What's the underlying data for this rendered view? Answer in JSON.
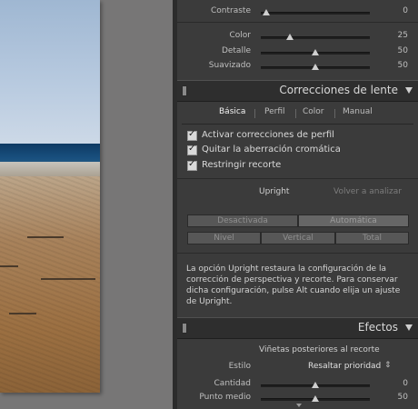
{
  "detail_sliders": [
    {
      "label": "Contraste",
      "value": "0",
      "pos": 0.05
    },
    {
      "label": "Color",
      "value": "25",
      "pos": 0.27
    },
    {
      "label": "Detalle",
      "value": "50",
      "pos": 0.5
    },
    {
      "label": "Suavizado",
      "value": "50",
      "pos": 0.5
    }
  ],
  "lens_section": {
    "title": "Correcciones de lente",
    "tabs": [
      "Básica",
      "Perfil",
      "Color",
      "Manual"
    ],
    "checkboxes": [
      "Activar correcciones de perfil",
      "Quitar la aberración cromática",
      "Restringir recorte"
    ],
    "upright_label": "Upright",
    "reanalyze_label": "Volver a analizar",
    "upright_buttons_row1": [
      "Desactivada",
      "Automática"
    ],
    "upright_buttons_row2": [
      "Nivel",
      "Vertical",
      "Total"
    ],
    "description": "La opción Upright restaura la configuración de la corrección de perspectiva y recorte. Para conservar dicha configuración, pulse Alt cuando elija un ajuste de Upright."
  },
  "effects_section": {
    "title": "Efectos",
    "subtitle": "Viñetas posteriores al recorte",
    "style_label": "Estilo",
    "style_value": "Resaltar prioridad",
    "sliders": [
      {
        "label": "Cantidad",
        "value": "0",
        "pos": 0.5
      },
      {
        "label": "Punto medio",
        "value": "50",
        "pos": 0.5
      }
    ]
  }
}
